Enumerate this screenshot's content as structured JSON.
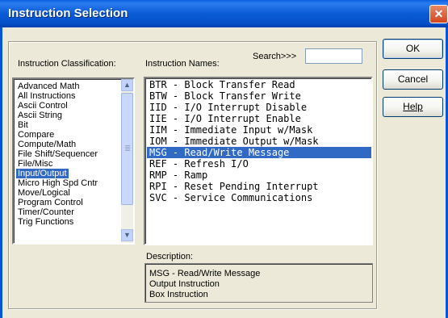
{
  "dialog": {
    "title": "Instruction Selection",
    "close_glyph": "✕"
  },
  "labels": {
    "classification": "Instruction Classification:",
    "names": "Instruction Names:",
    "search": "Search>>>",
    "description": "Description:"
  },
  "search": {
    "value": ""
  },
  "classifications": [
    {
      "label": "Advanced Math"
    },
    {
      "label": "All Instructions"
    },
    {
      "label": "Ascii Control"
    },
    {
      "label": "Ascii String"
    },
    {
      "label": "Bit"
    },
    {
      "label": "Compare"
    },
    {
      "label": "Compute/Math"
    },
    {
      "label": "File Shift/Sequencer"
    },
    {
      "label": "File/Misc"
    },
    {
      "label": "Input/Output"
    },
    {
      "label": "Micro High Spd Cntr"
    },
    {
      "label": "Move/Logical"
    },
    {
      "label": "Program Control"
    },
    {
      "label": "Timer/Counter"
    },
    {
      "label": "Trig Functions"
    }
  ],
  "selected_classification": "Input/Output",
  "instructions": [
    {
      "label": "BTR - Block Transfer Read"
    },
    {
      "label": "BTW - Block Transfer Write"
    },
    {
      "label": "IID - I/O Interrupt Disable"
    },
    {
      "label": "IIE - I/O Interrupt Enable"
    },
    {
      "label": "IIM - Immediate Input w/Mask"
    },
    {
      "label": "IOM - Immediate Output w/Mask"
    },
    {
      "label": "MSG - Read/Write Message"
    },
    {
      "label": "REF - Refresh I/O"
    },
    {
      "label": "RMP - Ramp"
    },
    {
      "label": "RPI - Reset Pending Interrupt"
    },
    {
      "label": "SVC - Service Communications"
    }
  ],
  "selected_instruction": "MSG - Read/Write Message",
  "description": {
    "lines": [
      "MSG - Read/Write Message",
      "Output Instruction",
      "Box Instruction"
    ]
  },
  "buttons": {
    "ok": "OK",
    "cancel": "Cancel",
    "help": "Help"
  },
  "scrollbar": {
    "up_glyph": "▲",
    "down_glyph": "▼"
  },
  "colors": {
    "title_bar": "#0a5bd6",
    "selection": "#316ac5",
    "dialog_bg": "#ece9d8"
  }
}
